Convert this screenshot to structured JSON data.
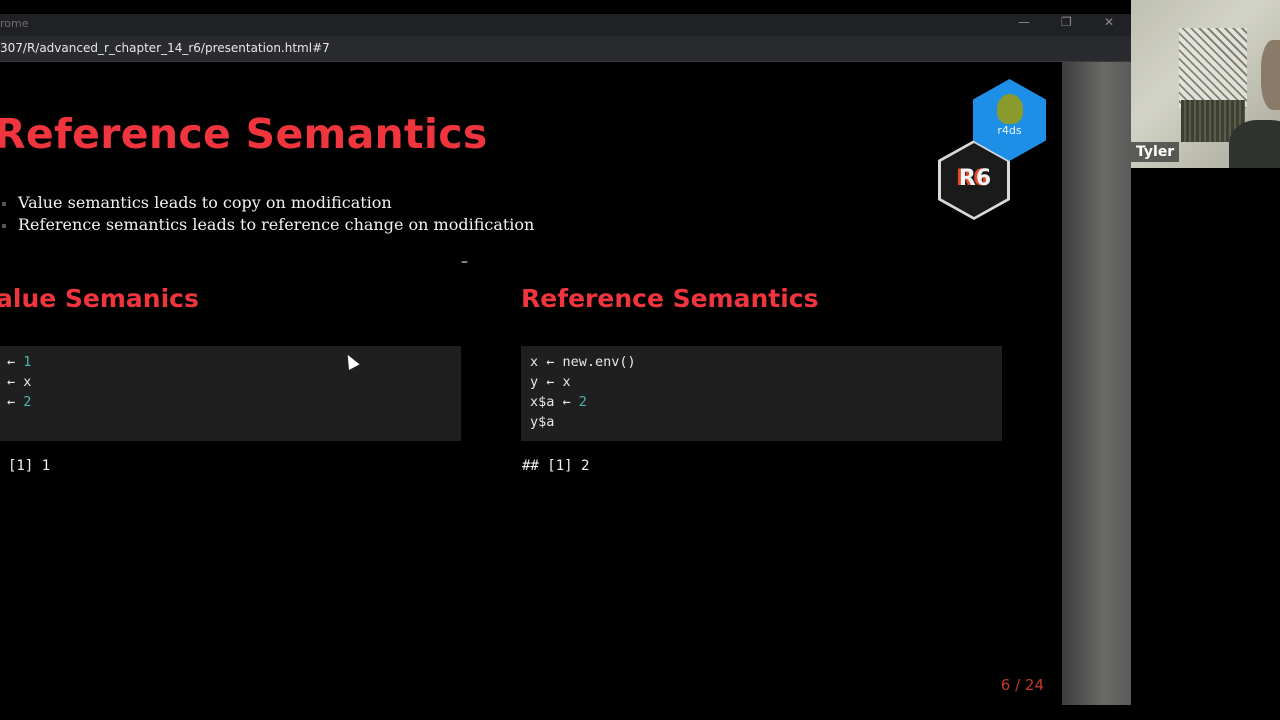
{
  "window": {
    "title": "rome",
    "url": "307/R/advanced_r_chapter_14_r6/presentation.html#7"
  },
  "slide": {
    "title": "Reference Semantics",
    "bullets": [
      "Value semantics leads to copy on modification",
      "Reference semantics leads to reference change on modification"
    ],
    "left": {
      "heading": "alue Semanics",
      "code": [
        {
          "pre": "← ",
          "num": "1"
        },
        {
          "pre": "← x",
          "num": ""
        },
        {
          "pre": "← ",
          "num": "2"
        }
      ],
      "output": "[1] 1"
    },
    "right": {
      "heading": "Reference Semantics",
      "code": [
        {
          "pre": "x ← new.env()",
          "num": ""
        },
        {
          "pre": "y ← x",
          "num": ""
        },
        {
          "pre": "x$a ← ",
          "num": "2"
        },
        {
          "pre": "y$a",
          "num": ""
        }
      ],
      "output": "## [1] 2"
    },
    "page": "6 / 24",
    "logos": {
      "r6": "R6",
      "r4ds": "r4ds"
    }
  },
  "video": {
    "participant": "Tyler"
  },
  "colors": {
    "accent": "#f0353e",
    "number": "#4cb5ab",
    "code_bg": "#1f1f1f"
  }
}
